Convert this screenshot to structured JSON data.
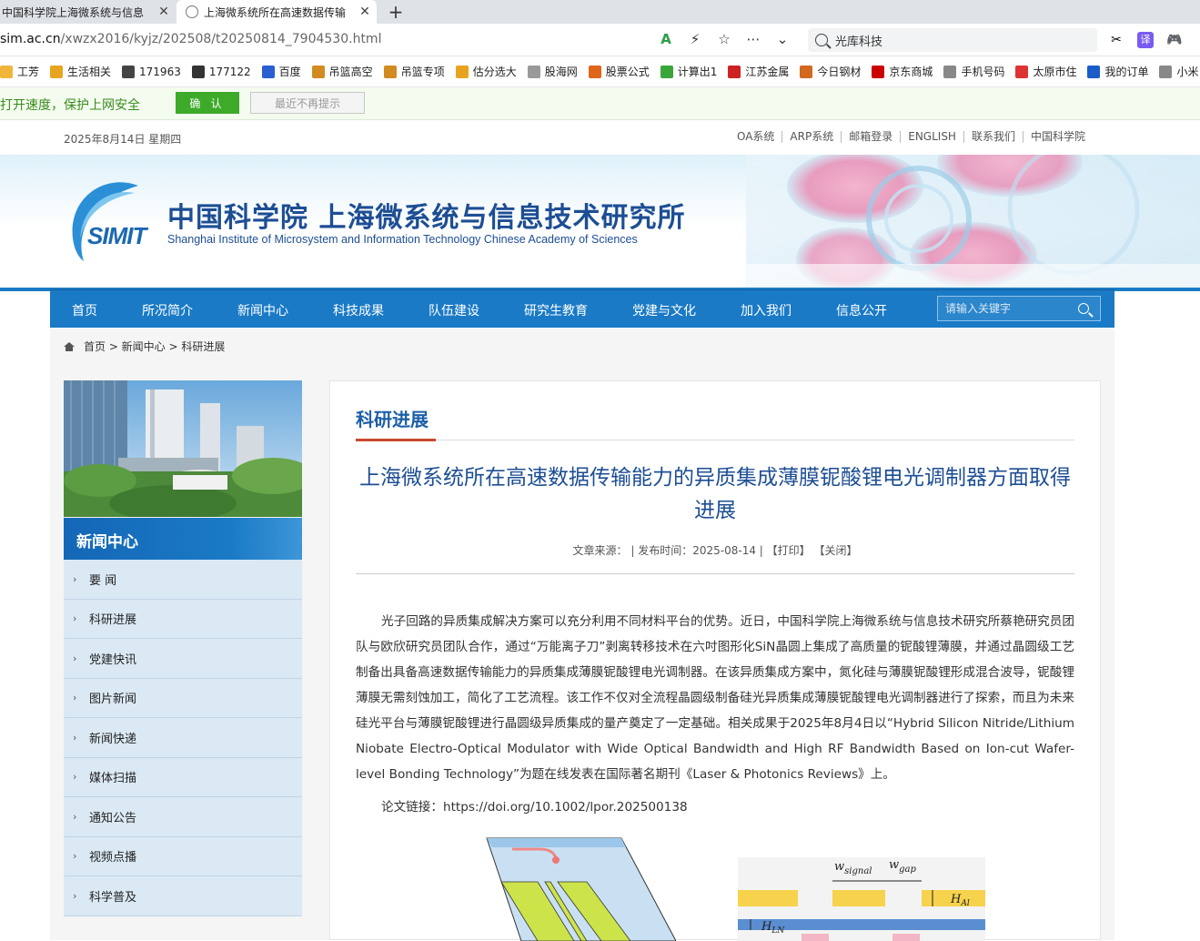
{
  "browser": {
    "tabs": [
      {
        "title": "中国科学院上海微系统与信息",
        "active": false
      },
      {
        "title": "上海微系统所在高速数据传输",
        "active": true
      }
    ],
    "url_domain": "sim.ac.cn",
    "url_path": "/xwzx2016/kyjz/202508/t20250814_7904530.html",
    "search_text": "光库科技",
    "bookmarks": [
      "工芳",
      "生活相关",
      "171963",
      "177122",
      "百度",
      "吊篮高空",
      "吊篮专项",
      "估分选大",
      "股海网",
      "股票公式",
      "计算出1",
      "江苏金属",
      "今日钢材",
      "京东商城",
      "手机号码",
      "太原市住",
      "我的订单",
      "小米"
    ],
    "notice_text": "打开速度，保护上网安全",
    "notice_ok": "确 认",
    "notice_later": "最近不再提示"
  },
  "site": {
    "date": "2025年8月14日 星期四",
    "top_links": [
      "OA系统",
      "ARP系统",
      "邮箱登录",
      "ENGLISH",
      "联系我们",
      "中国科学院"
    ],
    "logo_text": "SIMIT",
    "name_cn": "中国科学院 上海微系统与信息技术研究所",
    "name_en": "Shanghai Institute of Microsystem and Information Technology Chinese Academy of Sciences",
    "nav": [
      "首页",
      "所况简介",
      "新闻中心",
      "科技成果",
      "队伍建设",
      "研究生教育",
      "党建与文化",
      "加入我们",
      "信息公开"
    ],
    "nav_search_placeholder": "请输入关键字",
    "breadcrumb": "首页 > 新闻中心 > 科研进展",
    "accent_color": "#1a7ac6"
  },
  "sidebar": {
    "heading": "新闻中心",
    "items": [
      "要 闻",
      "科研进展",
      "党建快讯",
      "图片新闻",
      "新闻快递",
      "媒体扫描",
      "通知公告",
      "视频点播",
      "科学普及"
    ]
  },
  "article": {
    "section": "科研进展",
    "title": "上海微系统所在高速数据传输能力的异质集成薄膜铌酸锂电光调制器方面取得进展",
    "meta": "文章来源：  |  发布时间：2025-08-14  |  【打印】 【关闭】",
    "body": "光子回路的异质集成解决方案可以充分利用不同材料平台的优势。近日，中国科学院上海微系统与信息技术研究所蔡艳研究员团队与欧欣研究员团队合作，通过“万能离子刀”剥离转移技术在六吋图形化SiN晶圆上集成了高质量的铌酸锂薄膜，并通过晶圆级工艺制备出具备高速数据传输能力的异质集成薄膜铌酸锂电光调制器。在该异质集成方案中，氮化硅与薄膜铌酸锂形成混合波导，铌酸锂薄膜无需刻蚀加工，简化了工艺流程。该工作不仅对全流程晶圆级制备硅光异质集成薄膜铌酸锂电光调制器进行了探索，而且为未来硅光平台与薄膜铌酸锂进行晶圆级异质集成的量产奠定了一定基础。相关成果于2025年8月4日以“Hybrid Silicon Nitride/Lithium Niobate Electro-Optical Modulator with Wide Optical Bandwidth and High RF Bandwidth Based on Ion-cut Wafer-level Bonding Technology”为题在线发表在国际著名期刊《Laser & Photonics Reviews》上。",
    "link_label": "论文链接：https://doi.org/10.1002/lpor.202500138",
    "figure_labels": {
      "w_signal": "w",
      "w_signal_sub": "signal",
      "w_gap": "w",
      "w_gap_sub": "gap",
      "h_al": "H",
      "h_al_sub": "Al",
      "h_ln": "H",
      "h_ln_sub": "LN"
    }
  }
}
